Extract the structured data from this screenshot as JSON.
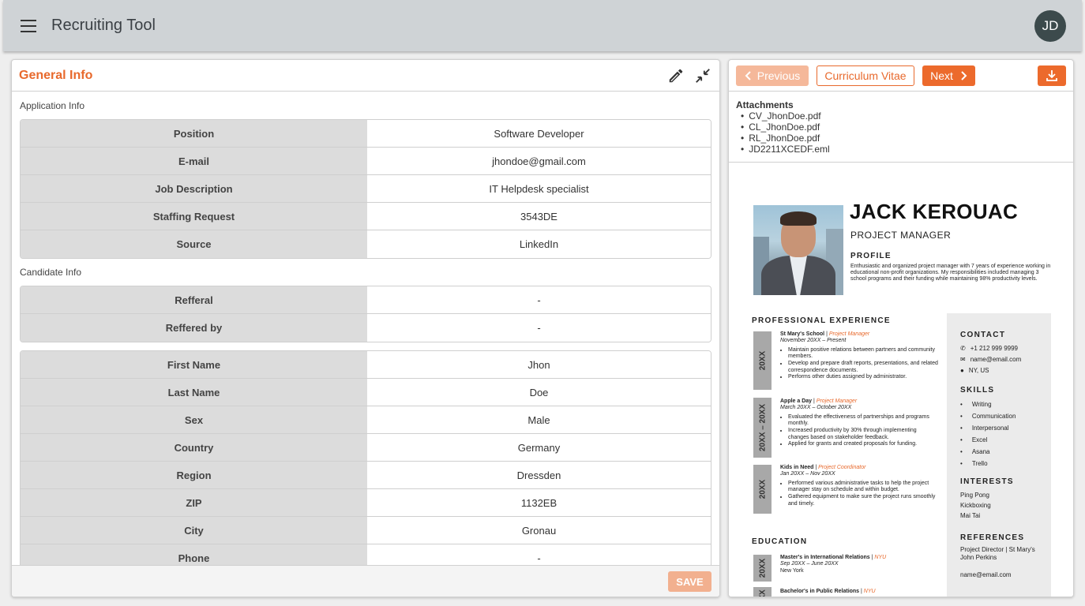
{
  "app": {
    "title": "Recruiting Tool",
    "user_initials": "JD"
  },
  "general": {
    "title": "General Info",
    "application_label": "Application Info",
    "application": [
      {
        "key": "Position",
        "value": "Software Developer"
      },
      {
        "key": "E-mail",
        "value": "jhondoe@gmail.com"
      },
      {
        "key": "Job Description",
        "value": "IT Helpdesk specialist"
      },
      {
        "key": "Staffing Request",
        "value": "3543DE"
      },
      {
        "key": "Source",
        "value": "LinkedIn"
      }
    ],
    "candidate_label": "Candidate Info",
    "referral": [
      {
        "key": "Refferal",
        "value": "-"
      },
      {
        "key": "Reffered by",
        "value": "-"
      }
    ],
    "candidate": [
      {
        "key": "First Name",
        "value": "Jhon"
      },
      {
        "key": "Last Name",
        "value": "Doe"
      },
      {
        "key": "Sex",
        "value": "Male"
      },
      {
        "key": "Country",
        "value": "Germany"
      },
      {
        "key": "Region",
        "value": "Dressden"
      },
      {
        "key": "ZIP",
        "value": "1132EB"
      },
      {
        "key": "City",
        "value": "Gronau"
      },
      {
        "key": "Phone",
        "value": "-"
      }
    ],
    "save_label": "SAVE"
  },
  "viewer": {
    "prev_label": "Previous",
    "doc_label": "Curriculum Vitae",
    "next_label": "Next",
    "attachments_title": "Attachments",
    "attachments": [
      "CV_JhonDoe.pdf",
      "CL_JhonDoe.pdf",
      "RL_JhonDoe.pdf",
      "JD2211XCEDF.eml"
    ]
  },
  "cv": {
    "name": "JACK KEROUAC",
    "role": "PROJECT MANAGER",
    "profile_heading": "PROFILE",
    "profile_text": "Enthusiastic and organized project manager with 7 years of experience working in educational non-profit organizations. My responsibilities included managing 3 school programs and their funding while maintaining 98% productivity levels.",
    "experience_heading": "PROFESSIONAL EXPERIENCE",
    "jobs": [
      {
        "org": "St Mary's School",
        "role": "Project Manager",
        "dates": "November 20XX – Present",
        "year": "20XX",
        "bullets": [
          "Maintain positive relations between partners and community members.",
          "Develop and prepare draft reports, presentations, and related correspondence documents.",
          "Performs other duties assigned by administrator."
        ]
      },
      {
        "org": "Apple a Day",
        "role": "Project Manager",
        "dates": "March 20XX – October 20XX",
        "year": "20XX – 20XX",
        "bullets": [
          "Evaluated the effectiveness of partnerships and programs monthly.",
          "Increased productivity by 30% through implementing changes based on stakeholder feedback.",
          "Applied for grants and created proposals for funding."
        ]
      },
      {
        "org": "Kids in Need",
        "role": "Project Coordinator",
        "dates": "Jan 20XX – Nov 20XX",
        "year": "20XX",
        "bullets": [
          "Performed various administrative tasks to help the project manager stay on schedule and within budget.",
          "Gathered equipment to make sure the project runs smoothly and timely."
        ]
      }
    ],
    "education_heading": "EDUCATION",
    "education": [
      {
        "degree": "Master's in International Relations",
        "school": "NYU",
        "dates": "Sep 20XX – June 20XX",
        "place": "New York",
        "year": "20XX"
      },
      {
        "degree": "Bachelor's in Public Relations",
        "school": "NYU",
        "year": "XX"
      }
    ],
    "contact_heading": "CONTACT",
    "contact": {
      "phone": "+1 212 999 9999",
      "email": "name@email.com",
      "location": "NY, US"
    },
    "skills_heading": "SKILLS",
    "skills": [
      "Writing",
      "Communication",
      "Interpersonal",
      "Excel",
      "Asana",
      "Trello"
    ],
    "interests_heading": "INTERESTS",
    "interests": [
      "Ping Pong",
      "Kickboxing",
      "Mai Tai"
    ],
    "references_heading": "REFERENCES",
    "reference_role": "Project Director | St Mary's",
    "reference_name": "John Perkins",
    "reference_email": "name@email.com"
  }
}
